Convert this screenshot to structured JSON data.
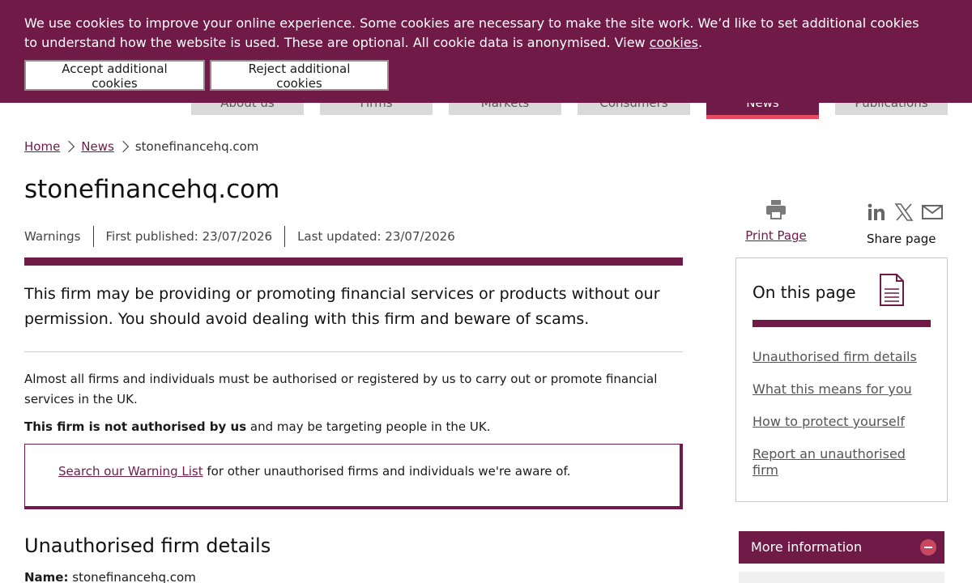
{
  "cookie_banner": {
    "text_line": "We use cookies to improve your online experience. Some cookies are necessary to make the site work. We’d like to set additional cookies to understand how the website is used. These are optional. All cookie data is anonymised. View ",
    "link": "cookies",
    "end": ".",
    "accept_label": "Accept additional cookies",
    "reject_label": "Reject additional cookies"
  },
  "nav": {
    "tabs": [
      {
        "label": "About us"
      },
      {
        "label": "Firms"
      },
      {
        "label": "Markets"
      },
      {
        "label": "Consumers"
      },
      {
        "label": "News"
      },
      {
        "label": "Publications"
      }
    ],
    "active": "News"
  },
  "breadcrumb": {
    "home": "Home",
    "news": "News",
    "current": "stonefinancehq.com"
  },
  "page": {
    "title": "stonefinancehq.com",
    "meta": {
      "type": "Warnings",
      "first_published": "First published: 23/07/2026",
      "last_updated": "Last updated: 23/07/2026"
    },
    "lead": "This firm may be providing or promoting financial services or products without our permission. You should avoid dealing with this firm and beware of scams.",
    "p1": "Almost all firms and individuals must be authorised or registered by us to carry out or promote financial services in the UK.",
    "p2_bold": "This firm is not authorised by us",
    "p2_rest": " and may be targeting people in the UK.",
    "callout_link": "Search our Warning List",
    "callout_rest": " for other unauthorised firms and individuals we're aware of.",
    "section_title": "Unauthorised firm details",
    "name_label": "Name:",
    "name_value": " stonefinancehq.com"
  },
  "tools": {
    "print_label": "Print Page",
    "share_label": "Share page",
    "icons": [
      "printer-icon",
      "linkedin-icon",
      "x-icon",
      "email-icon"
    ]
  },
  "on_this_page": {
    "title": "On this page",
    "links": [
      "Unauthorised firm details",
      "What this means for you",
      "How to protect yourself",
      "Report an unauthorised firm"
    ]
  },
  "more_info": {
    "label": "More information"
  },
  "colors": {
    "brand": "#701a47",
    "accent": "#e34b5f"
  }
}
